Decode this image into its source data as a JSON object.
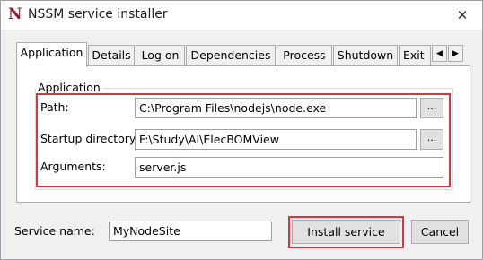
{
  "window": {
    "title": "NSSM service installer",
    "icon_letter": "N",
    "close_glyph": "✕"
  },
  "tabs": [
    {
      "label": "Application",
      "active": true
    },
    {
      "label": "Details"
    },
    {
      "label": "Log on"
    },
    {
      "label": "Dependencies"
    },
    {
      "label": "Process"
    },
    {
      "label": "Shutdown"
    },
    {
      "label": "Exit"
    }
  ],
  "tab_scroll": {
    "left": "◀",
    "right": "▶"
  },
  "application": {
    "group_title": "Application",
    "path_label": "Path:",
    "path_value": "C:\\Program Files\\nodejs\\node.exe",
    "startup_label": "Startup directory:",
    "startup_value": "F:\\Study\\AI\\ElecBOMView",
    "arguments_label": "Arguments:",
    "arguments_value": "server.js",
    "browse_label": "..."
  },
  "footer": {
    "service_name_label": "Service name:",
    "service_name_value": "MyNodeSite",
    "install_label": "Install service",
    "cancel_label": "Cancel"
  },
  "colors": {
    "highlight": "#d9363e",
    "icon": "#9b1c2c"
  }
}
